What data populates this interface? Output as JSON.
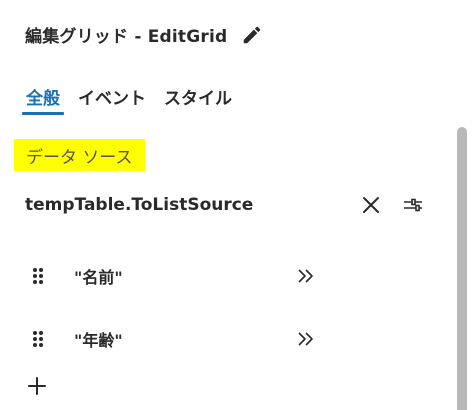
{
  "header": {
    "title": "編集グリッド - EditGrid",
    "edit_icon": "pencil-icon"
  },
  "tabs": [
    {
      "label": "全般",
      "active": true
    },
    {
      "label": "イベント",
      "active": false
    },
    {
      "label": "スタイル",
      "active": false
    }
  ],
  "data_source": {
    "section_label": "データ ソース",
    "value": "tempTable.ToListSource",
    "clear_icon": "close-icon",
    "settings_icon": "sliders-icon"
  },
  "fields": [
    {
      "label": "\"名前\"",
      "drag_icon": "drag-handle-icon",
      "expand_icon": "double-chevron-right-icon"
    },
    {
      "label": "\"年齢\"",
      "drag_icon": "drag-handle-icon",
      "expand_icon": "double-chevron-right-icon"
    }
  ],
  "add": {
    "icon": "plus-icon"
  },
  "colors": {
    "accent": "#1a6fb6",
    "highlight": "#ffff00",
    "text": "#2a2a2a",
    "muted": "#555555"
  }
}
